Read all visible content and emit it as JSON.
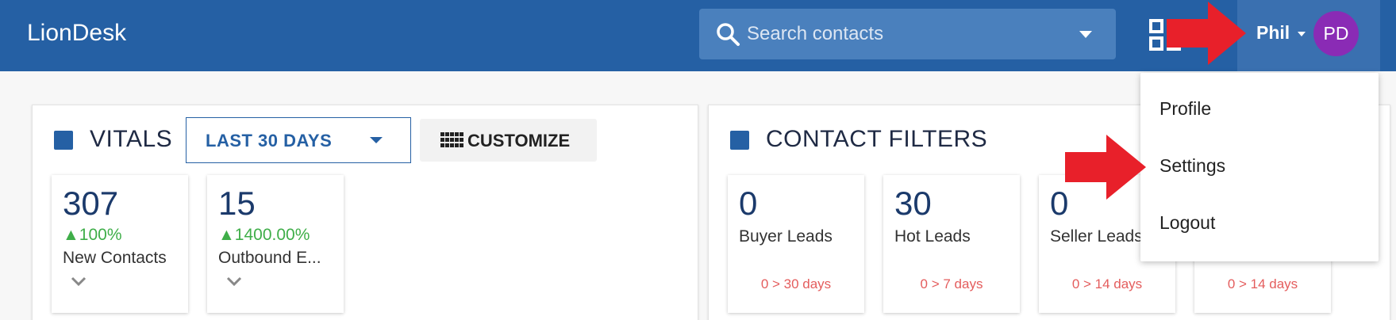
{
  "header": {
    "brand": "LionDesk",
    "search": {
      "placeholder": "Search contacts",
      "icon": "search-icon"
    },
    "apps_icon": "apps-grid-icon",
    "user": {
      "name": "Phil",
      "initials": "PD",
      "avatar_color": "#8a2bb5"
    }
  },
  "vitals": {
    "title": "VITALS",
    "range": "LAST 30 DAYS",
    "customize_label": "CUSTOMIZE",
    "cards": [
      {
        "value": "307",
        "delta": "100%",
        "label": "New Contacts"
      },
      {
        "value": "15",
        "delta": "1400.00%",
        "label": "Outbound E..."
      }
    ]
  },
  "contact_filters": {
    "title": "CONTACT FILTERS",
    "cards": [
      {
        "value": "0",
        "label": "Buyer Leads",
        "sub": "0 > 30 days"
      },
      {
        "value": "30",
        "label": "Hot Leads",
        "sub": "0 > 7 days"
      },
      {
        "value": "0",
        "label": "Seller Leads",
        "sub": "0 > 14 days"
      },
      {
        "value": "",
        "label": "",
        "sub": "0 > 14 days"
      }
    ]
  },
  "user_menu": {
    "items": [
      {
        "label": "Profile"
      },
      {
        "label": "Settings"
      },
      {
        "label": "Logout"
      }
    ]
  },
  "colors": {
    "header_bg": "#2560a4",
    "accent": "#2560a4",
    "positive": "#3fae49",
    "warning_text": "#e45d5d",
    "annotation_arrow": "#e8202a"
  }
}
